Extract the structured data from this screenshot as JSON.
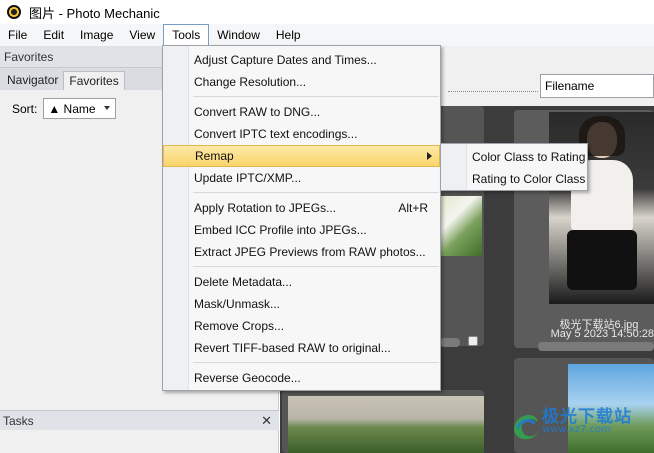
{
  "window": {
    "title": "图片 - Photo Mechanic"
  },
  "menubar": {
    "items": [
      "File",
      "Edit",
      "Image",
      "View",
      "Tools",
      "Window",
      "Help"
    ]
  },
  "left_panel": {
    "header": "Favorites",
    "tabs": [
      "Navigator",
      "Favorites"
    ],
    "sort_label": "Sort:",
    "sort_value": "▲ Name",
    "tasks_header": "Tasks",
    "tasks_close": "✕"
  },
  "toolbar": {
    "sort_field": "Filename"
  },
  "thumbnails": [
    {
      "caption_name": "极光下载站6.jpg",
      "caption_date": "May 5 2023 14:50:28"
    }
  ],
  "tools_menu": {
    "items": [
      {
        "label": "Adjust Capture Dates and Times..."
      },
      {
        "label": "Change Resolution..."
      },
      {
        "label": "Convert RAW to DNG..."
      },
      {
        "label": "Convert IPTC text encodings..."
      },
      {
        "label": "Remap"
      },
      {
        "label": "Update IPTC/XMP..."
      },
      {
        "label": "Apply Rotation to JPEGs...",
        "shortcut": "Alt+R"
      },
      {
        "label": "Embed ICC Profile into JPEGs..."
      },
      {
        "label": "Extract JPEG Previews from RAW photos..."
      },
      {
        "label": "Delete Metadata..."
      },
      {
        "label": "Mask/Unmask..."
      },
      {
        "label": "Remove Crops..."
      },
      {
        "label": "Revert TIFF-based RAW to original..."
      },
      {
        "label": "Reverse Geocode..."
      }
    ]
  },
  "remap_submenu": {
    "items": [
      "Color Class to Rating",
      "Rating to Color Class"
    ]
  },
  "watermark": {
    "text": "极光下载站",
    "url": "www.xz7.com"
  },
  "colors": {
    "menu_highlight": "#f9d46b",
    "grid_bg": "#3c3c3c",
    "watermark": "#1e7bd6"
  }
}
